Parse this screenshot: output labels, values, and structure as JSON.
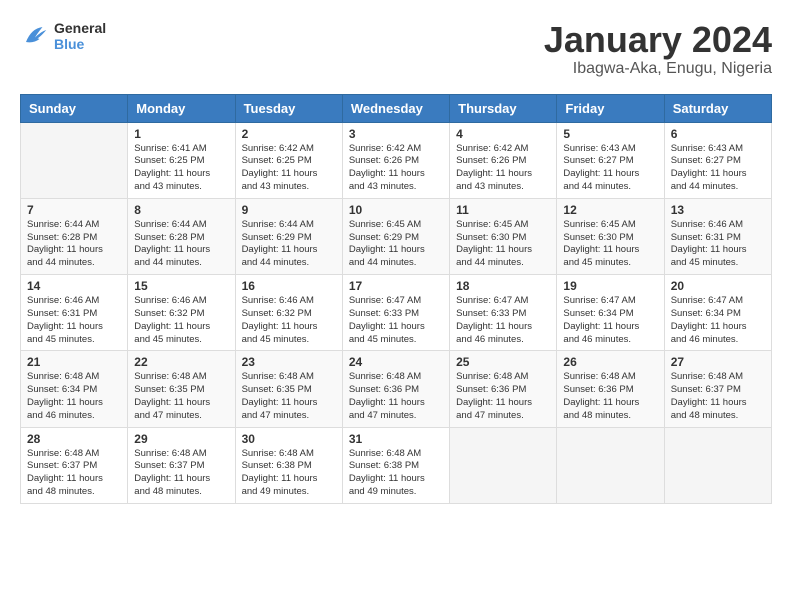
{
  "header": {
    "logo_line1": "General",
    "logo_line2": "Blue",
    "main_title": "January 2024",
    "subtitle": "Ibagwa-Aka, Enugu, Nigeria"
  },
  "weekdays": [
    "Sunday",
    "Monday",
    "Tuesday",
    "Wednesday",
    "Thursday",
    "Friday",
    "Saturday"
  ],
  "weeks": [
    [
      {
        "day": "",
        "sunrise": "",
        "sunset": "",
        "daylight": ""
      },
      {
        "day": "1",
        "sunrise": "6:41 AM",
        "sunset": "6:25 PM",
        "daylight": "11 hours and 43 minutes."
      },
      {
        "day": "2",
        "sunrise": "6:42 AM",
        "sunset": "6:25 PM",
        "daylight": "11 hours and 43 minutes."
      },
      {
        "day": "3",
        "sunrise": "6:42 AM",
        "sunset": "6:26 PM",
        "daylight": "11 hours and 43 minutes."
      },
      {
        "day": "4",
        "sunrise": "6:42 AM",
        "sunset": "6:26 PM",
        "daylight": "11 hours and 43 minutes."
      },
      {
        "day": "5",
        "sunrise": "6:43 AM",
        "sunset": "6:27 PM",
        "daylight": "11 hours and 44 minutes."
      },
      {
        "day": "6",
        "sunrise": "6:43 AM",
        "sunset": "6:27 PM",
        "daylight": "11 hours and 44 minutes."
      }
    ],
    [
      {
        "day": "7",
        "sunrise": "6:44 AM",
        "sunset": "6:28 PM",
        "daylight": "11 hours and 44 minutes."
      },
      {
        "day": "8",
        "sunrise": "6:44 AM",
        "sunset": "6:28 PM",
        "daylight": "11 hours and 44 minutes."
      },
      {
        "day": "9",
        "sunrise": "6:44 AM",
        "sunset": "6:29 PM",
        "daylight": "11 hours and 44 minutes."
      },
      {
        "day": "10",
        "sunrise": "6:45 AM",
        "sunset": "6:29 PM",
        "daylight": "11 hours and 44 minutes."
      },
      {
        "day": "11",
        "sunrise": "6:45 AM",
        "sunset": "6:30 PM",
        "daylight": "11 hours and 44 minutes."
      },
      {
        "day": "12",
        "sunrise": "6:45 AM",
        "sunset": "6:30 PM",
        "daylight": "11 hours and 45 minutes."
      },
      {
        "day": "13",
        "sunrise": "6:46 AM",
        "sunset": "6:31 PM",
        "daylight": "11 hours and 45 minutes."
      }
    ],
    [
      {
        "day": "14",
        "sunrise": "6:46 AM",
        "sunset": "6:31 PM",
        "daylight": "11 hours and 45 minutes."
      },
      {
        "day": "15",
        "sunrise": "6:46 AM",
        "sunset": "6:32 PM",
        "daylight": "11 hours and 45 minutes."
      },
      {
        "day": "16",
        "sunrise": "6:46 AM",
        "sunset": "6:32 PM",
        "daylight": "11 hours and 45 minutes."
      },
      {
        "day": "17",
        "sunrise": "6:47 AM",
        "sunset": "6:33 PM",
        "daylight": "11 hours and 45 minutes."
      },
      {
        "day": "18",
        "sunrise": "6:47 AM",
        "sunset": "6:33 PM",
        "daylight": "11 hours and 46 minutes."
      },
      {
        "day": "19",
        "sunrise": "6:47 AM",
        "sunset": "6:34 PM",
        "daylight": "11 hours and 46 minutes."
      },
      {
        "day": "20",
        "sunrise": "6:47 AM",
        "sunset": "6:34 PM",
        "daylight": "11 hours and 46 minutes."
      }
    ],
    [
      {
        "day": "21",
        "sunrise": "6:48 AM",
        "sunset": "6:34 PM",
        "daylight": "11 hours and 46 minutes."
      },
      {
        "day": "22",
        "sunrise": "6:48 AM",
        "sunset": "6:35 PM",
        "daylight": "11 hours and 47 minutes."
      },
      {
        "day": "23",
        "sunrise": "6:48 AM",
        "sunset": "6:35 PM",
        "daylight": "11 hours and 47 minutes."
      },
      {
        "day": "24",
        "sunrise": "6:48 AM",
        "sunset": "6:36 PM",
        "daylight": "11 hours and 47 minutes."
      },
      {
        "day": "25",
        "sunrise": "6:48 AM",
        "sunset": "6:36 PM",
        "daylight": "11 hours and 47 minutes."
      },
      {
        "day": "26",
        "sunrise": "6:48 AM",
        "sunset": "6:36 PM",
        "daylight": "11 hours and 48 minutes."
      },
      {
        "day": "27",
        "sunrise": "6:48 AM",
        "sunset": "6:37 PM",
        "daylight": "11 hours and 48 minutes."
      }
    ],
    [
      {
        "day": "28",
        "sunrise": "6:48 AM",
        "sunset": "6:37 PM",
        "daylight": "11 hours and 48 minutes."
      },
      {
        "day": "29",
        "sunrise": "6:48 AM",
        "sunset": "6:37 PM",
        "daylight": "11 hours and 48 minutes."
      },
      {
        "day": "30",
        "sunrise": "6:48 AM",
        "sunset": "6:38 PM",
        "daylight": "11 hours and 49 minutes."
      },
      {
        "day": "31",
        "sunrise": "6:48 AM",
        "sunset": "6:38 PM",
        "daylight": "11 hours and 49 minutes."
      },
      {
        "day": "",
        "sunrise": "",
        "sunset": "",
        "daylight": ""
      },
      {
        "day": "",
        "sunrise": "",
        "sunset": "",
        "daylight": ""
      },
      {
        "day": "",
        "sunrise": "",
        "sunset": "",
        "daylight": ""
      }
    ]
  ]
}
